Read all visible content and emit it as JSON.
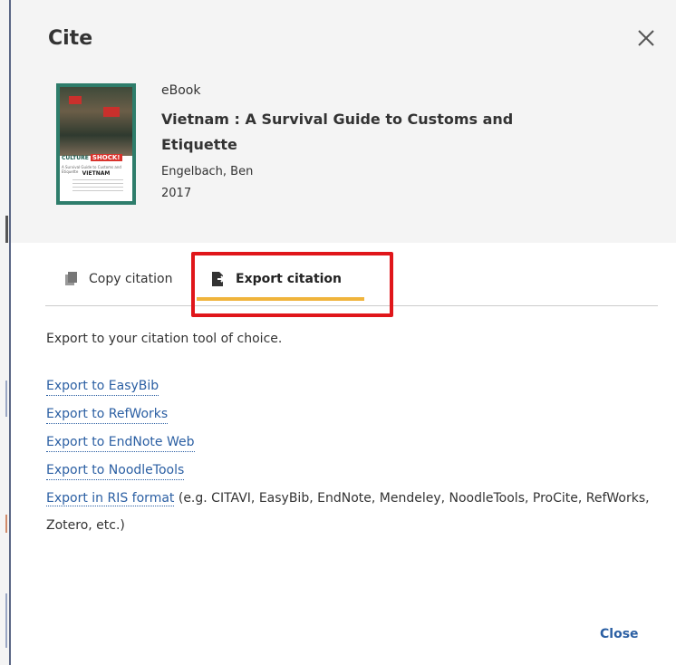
{
  "dialog": {
    "title": "Cite",
    "close_footer_label": "Close"
  },
  "record": {
    "type": "eBook",
    "title": "Vietnam : A Survival Guide to Customs and Etiquette",
    "author": "Engelbach, Ben",
    "year": "2017",
    "cover": {
      "brand_prefix": "CULTURE",
      "brand_word": "SHOCK!",
      "subtitle": "A Survival Guide to Customs and Etiquette",
      "country": "VIETNAM"
    }
  },
  "tabs": [
    {
      "label": "Copy citation",
      "icon": "copy-icon",
      "selected": false
    },
    {
      "label": "Export citation",
      "icon": "export-icon",
      "selected": true
    }
  ],
  "export": {
    "intro": "Export to your citation tool of choice.",
    "links": [
      "Export to EasyBib",
      "Export to RefWorks",
      "Export to EndNote Web",
      "Export to NoodleTools"
    ],
    "ris_link": "Export in RIS format",
    "ris_note": " (e.g. CITAVI, EasyBib, EndNote, Mendeley, NoodleTools, ProCite, RefWorks, Zotero, etc.)"
  },
  "colors": {
    "link": "#2b5fa3",
    "tab_underline": "#f0b43c",
    "highlight_box": "#e0161a",
    "header_bg": "#f4f4f4"
  }
}
